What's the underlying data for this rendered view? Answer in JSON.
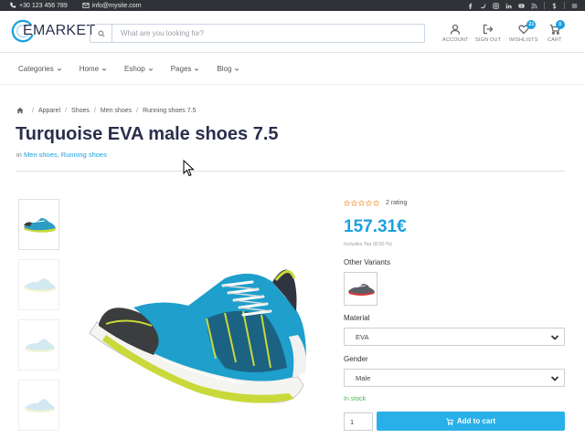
{
  "topbar": {
    "phone": "+30 123 456 789",
    "email": "info@mysite.com",
    "social_icons": [
      "facebook-icon",
      "twitter-icon",
      "instagram-icon",
      "linkedin-icon",
      "youtube-icon",
      "rss-icon",
      "dollar-icon",
      "menu-icon"
    ]
  },
  "header": {
    "logo_text": "EMARKET",
    "search_placeholder": "What are you looking for?",
    "account_label": "ACCOUNT",
    "signout_label": "SIGN OUT",
    "wishlists_label": "WISHLISTS",
    "wishlists_count": "21",
    "cart_label": "CART",
    "cart_count": "0"
  },
  "nav": {
    "items": [
      {
        "label": "Categories"
      },
      {
        "label": "Home"
      },
      {
        "label": "Eshop"
      },
      {
        "label": "Pages"
      },
      {
        "label": "Blog"
      }
    ]
  },
  "breadcrumb": [
    "Apparel",
    "Shoes",
    "Men shoes",
    "Running shoes 7.5"
  ],
  "product": {
    "title": "Turquoise EVA male shoes 7.5",
    "categories_prefix": "in",
    "categories": "Men shoes, Running shoes",
    "rating_text": "2 rating",
    "rating_value": 0,
    "rating_max": 5,
    "price": "157.31€",
    "tax_note": "Includes Tax (8.00 %)",
    "variants_label": "Other Variants",
    "material_label": "Material",
    "material_value": "EVA",
    "gender_label": "Gender",
    "gender_value": "Male",
    "stock_status": "In stock",
    "quantity": "1",
    "add_to_cart_label": "Add to cart"
  },
  "colors": {
    "accent": "#1aa0e0",
    "button": "#2ab0e8",
    "stock": "#46b450",
    "topbar": "#2f3337",
    "title": "#2b2f4c"
  }
}
